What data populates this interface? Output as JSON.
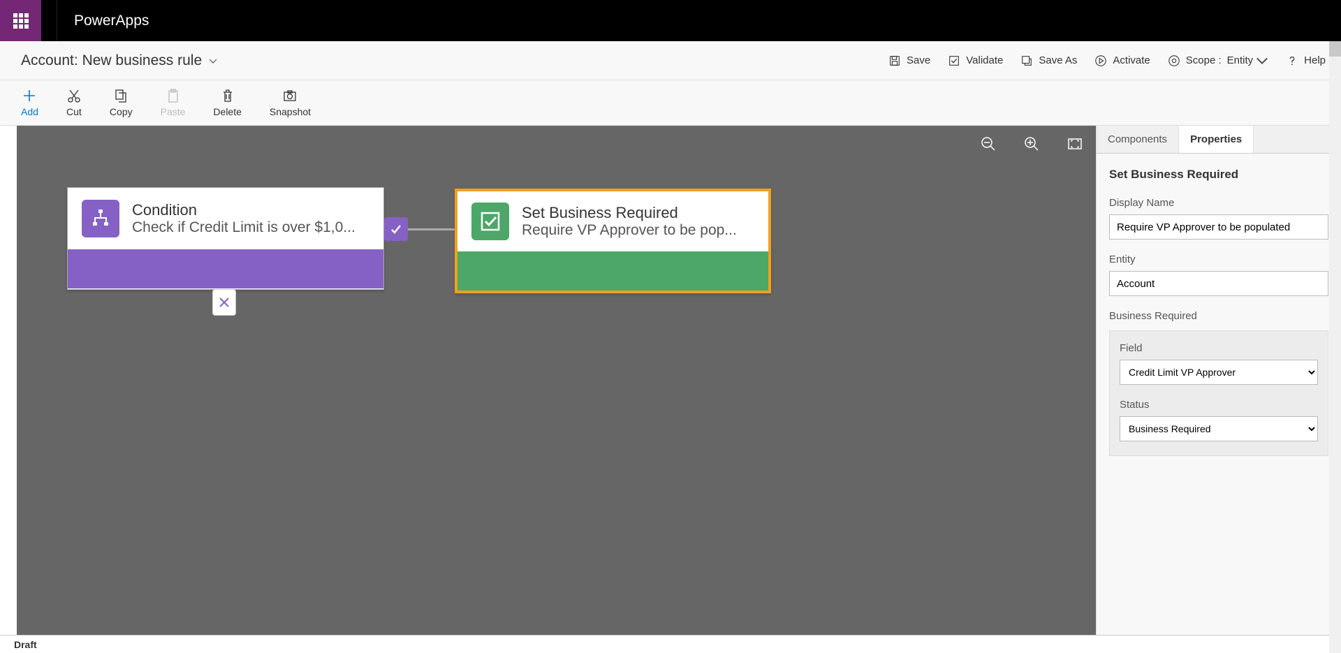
{
  "header": {
    "app_name": "PowerApps"
  },
  "title_bar": {
    "entity": "Account:",
    "rule_name": "New business rule",
    "actions": {
      "save": "Save",
      "validate": "Validate",
      "save_as": "Save As",
      "activate": "Activate",
      "scope_label": "Scope :",
      "scope_value": "Entity",
      "help": "Help"
    }
  },
  "toolbar": {
    "add": "Add",
    "cut": "Cut",
    "copy": "Copy",
    "paste": "Paste",
    "delete": "Delete",
    "snapshot": "Snapshot"
  },
  "canvas": {
    "condition": {
      "title": "Condition",
      "subtitle": "Check if Credit Limit is over $1,0..."
    },
    "action": {
      "title": "Set Business Required",
      "subtitle": "Require VP Approver to be pop..."
    }
  },
  "side_panel": {
    "tabs": {
      "components": "Components",
      "properties": "Properties"
    },
    "title": "Set Business Required",
    "display_name_label": "Display Name",
    "display_name_value": "Require VP Approver to be populated",
    "entity_label": "Entity",
    "entity_value": "Account",
    "section_title": "Business Required",
    "field_label": "Field",
    "field_value": "Credit Limit VP Approver",
    "status_label": "Status",
    "status_value": "Business Required"
  },
  "status_bar": {
    "state": "Draft"
  }
}
